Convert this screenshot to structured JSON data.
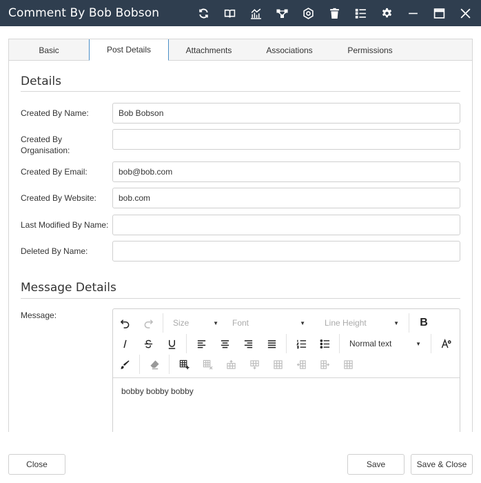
{
  "window": {
    "title": "Comment By Bob Bobson",
    "toolbar_icons": [
      "refresh-icon",
      "book-icon",
      "chart-icon",
      "workflow-icon",
      "settings-cog-icon",
      "trash-icon",
      "list-icon",
      "gear-icon",
      "minimize-icon",
      "maximize-icon",
      "close-icon"
    ]
  },
  "tabs": [
    {
      "label": "Basic",
      "active": false
    },
    {
      "label": "Post Details",
      "active": true
    },
    {
      "label": "Attachments",
      "active": false
    },
    {
      "label": "Associations",
      "active": false
    },
    {
      "label": "Permissions",
      "active": false
    }
  ],
  "details": {
    "title": "Details",
    "fields": [
      {
        "label": "Created By Name:",
        "value": "Bob Bobson"
      },
      {
        "label": "Created By Organisation:",
        "value": ""
      },
      {
        "label": "Created By Email:",
        "value": "bob@bob.com"
      },
      {
        "label": "Created By Website:",
        "value": "bob.com"
      },
      {
        "label": "Last Modified By Name:",
        "value": ""
      },
      {
        "label": "Deleted By Name:",
        "value": ""
      }
    ]
  },
  "message_details": {
    "title": "Message Details",
    "message_label": "Message:",
    "editor": {
      "size_placeholder": "Size",
      "font_placeholder": "Font",
      "line_height_placeholder": "Line Height",
      "bold_label": "B",
      "block_format": "Normal text",
      "content": "bobby bobby bobby"
    }
  },
  "footer": {
    "close_label": "Close",
    "save_label": "Save",
    "save_close_label": "Save & Close"
  },
  "colors": {
    "titlebar_bg": "#2f3e4f",
    "active_tab_border": "#4a8fc8"
  }
}
